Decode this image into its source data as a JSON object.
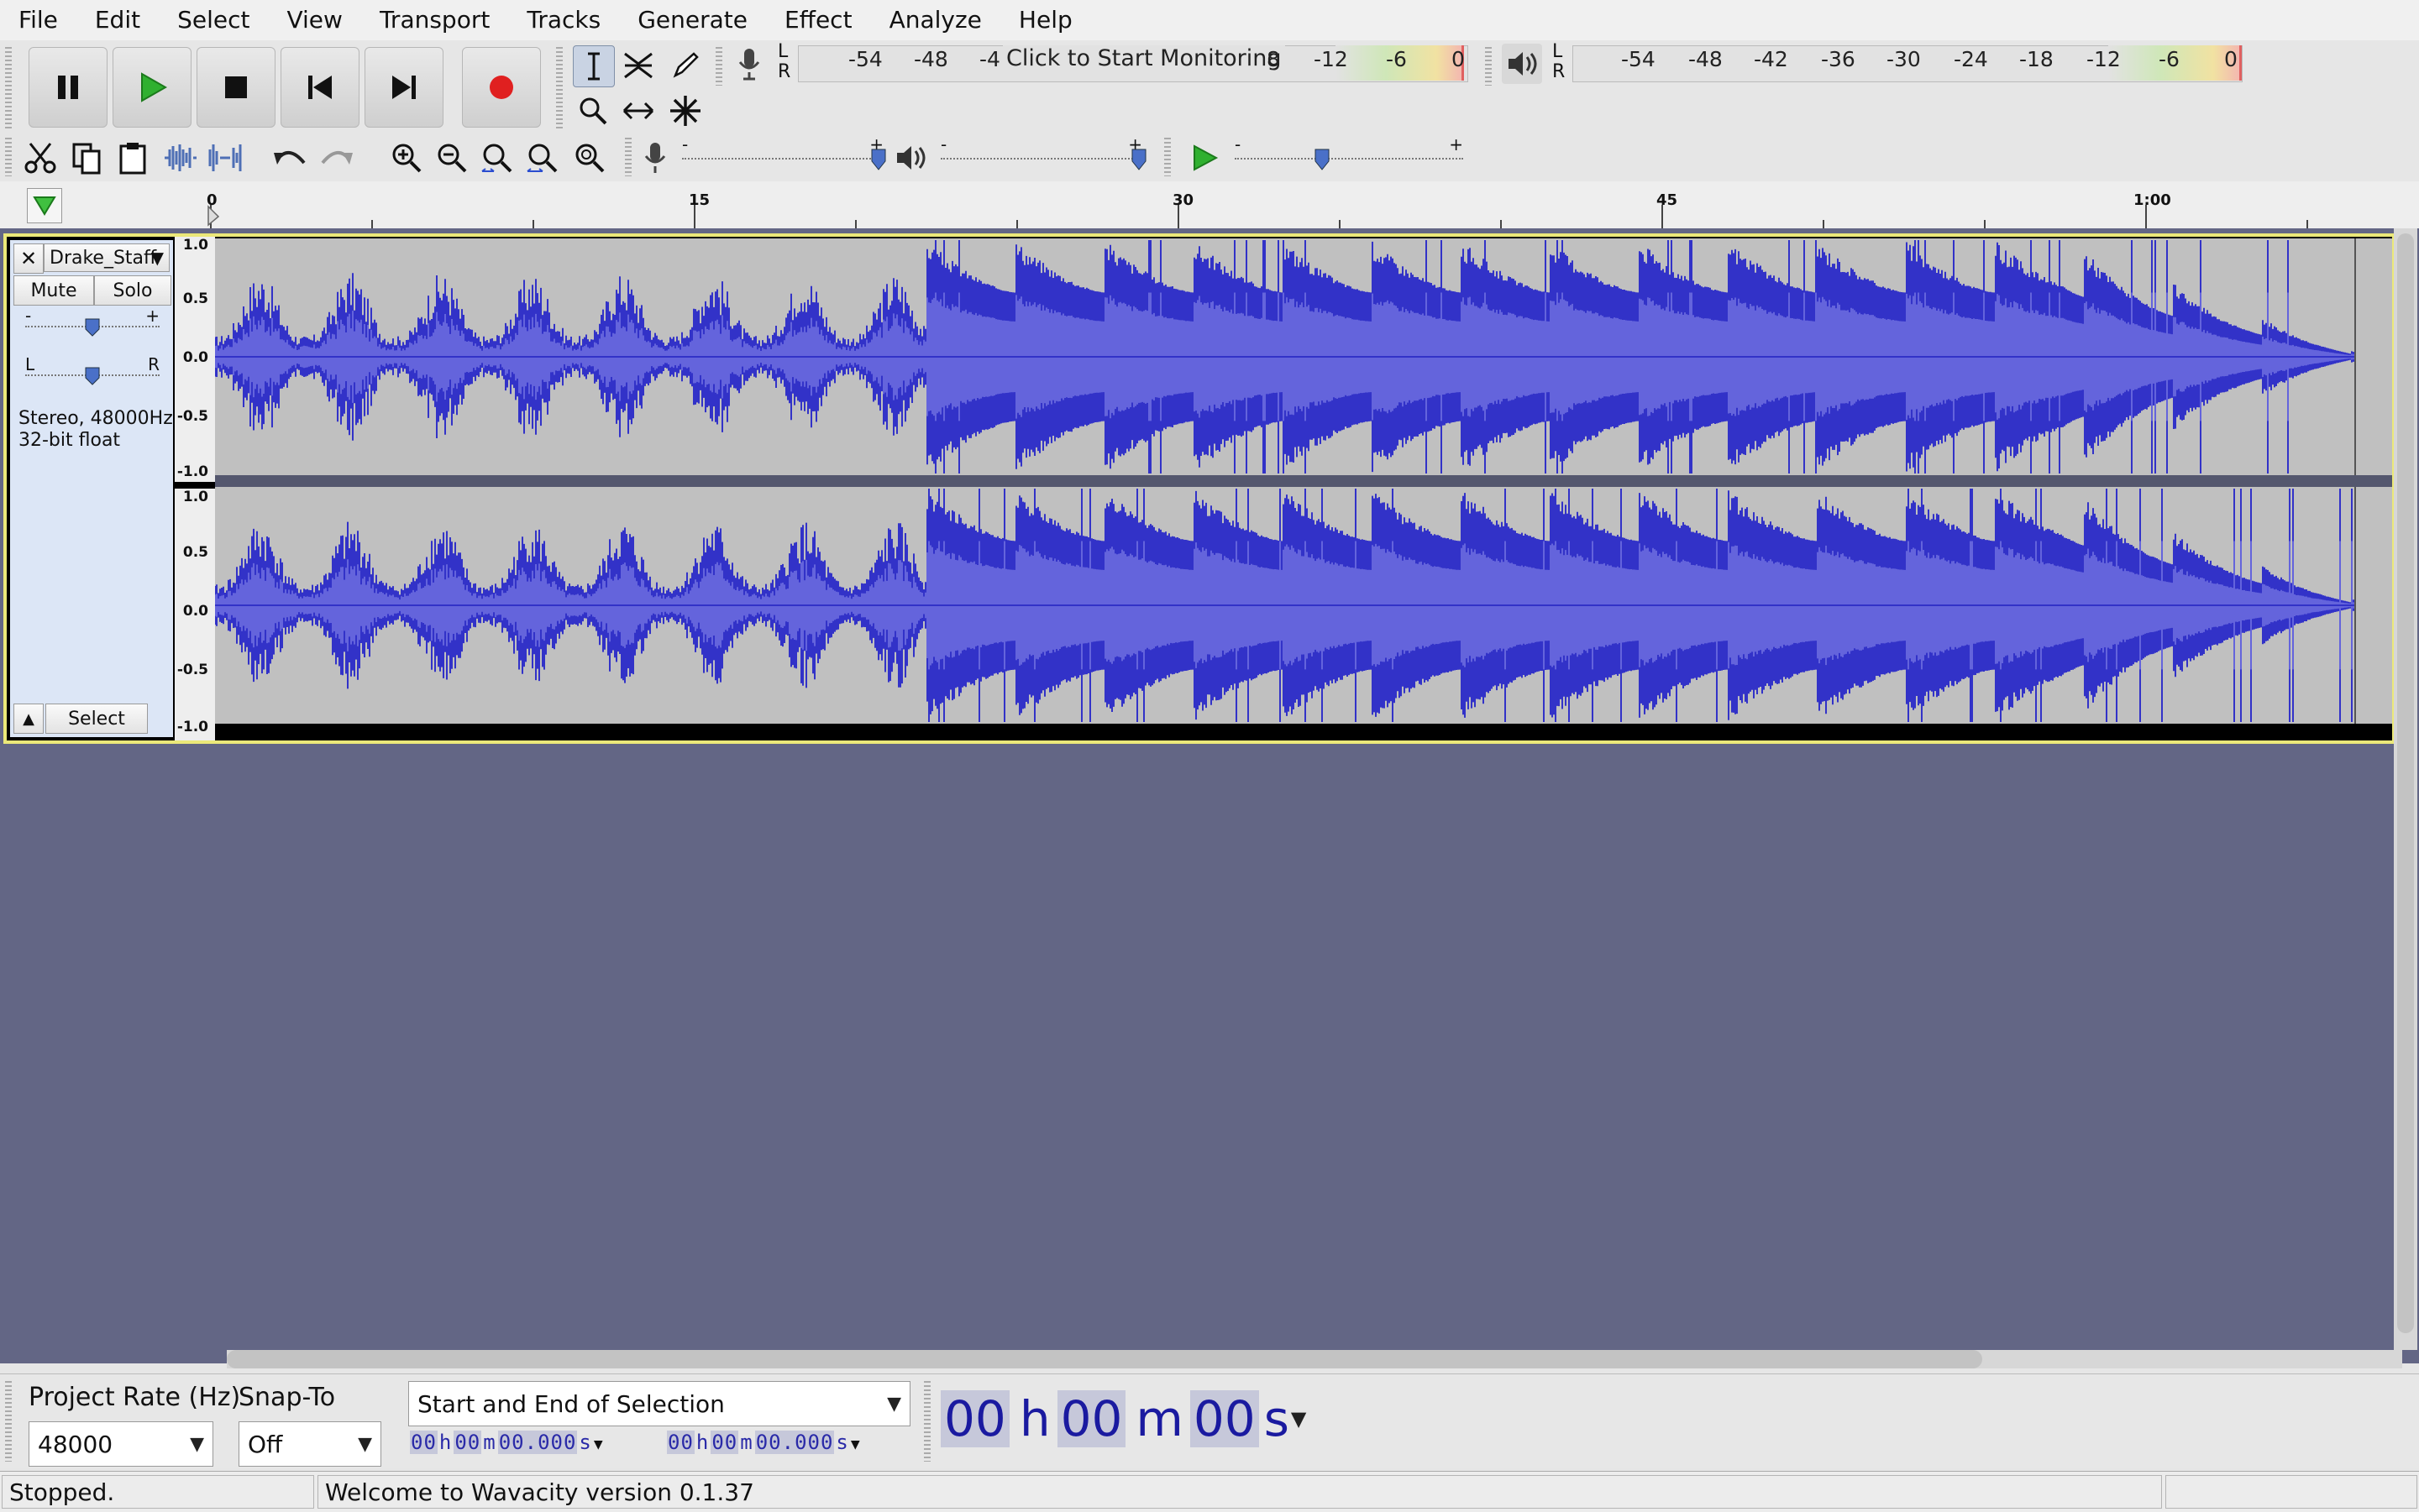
{
  "menu": [
    "File",
    "Edit",
    "Select",
    "View",
    "Transport",
    "Tracks",
    "Generate",
    "Effect",
    "Analyze",
    "Help"
  ],
  "record_meter": {
    "channels": [
      "L",
      "R"
    ],
    "ticks": [
      "-54",
      "-48",
      "-4",
      "8",
      "-12",
      "-6",
      "0"
    ],
    "prompt": "Click to Start Monitoring"
  },
  "playback_meter": {
    "channels": [
      "L",
      "R"
    ],
    "ticks": [
      "-54",
      "-48",
      "-42",
      "-36",
      "-30",
      "-24",
      "-18",
      "-12",
      "-6",
      "0"
    ]
  },
  "sliders": {
    "mic_minus": "-",
    "mic_plus": "+",
    "speaker_minus": "-",
    "speaker_plus": "+",
    "speed_minus": "-",
    "speed_plus": "+"
  },
  "ruler": {
    "labels": [
      "0",
      "15",
      "30",
      "45",
      "1:00"
    ]
  },
  "track": {
    "name": "Drake_Staff",
    "mute": "Mute",
    "solo": "Solo",
    "gain_minus": "-",
    "gain_plus": "+",
    "pan_left": "L",
    "pan_right": "R",
    "info_line1": "Stereo, 48000Hz",
    "info_line2": "32-bit float",
    "select": "Select",
    "scale": [
      "1.0",
      "0.5",
      "0.0",
      "-0.5",
      "-1.0"
    ]
  },
  "selection_toolbar": {
    "project_rate_label": "Project Rate (Hz)",
    "project_rate_value": "48000",
    "snap_label": "Snap-To",
    "snap_value": "Off",
    "selection_mode": "Start and End of Selection",
    "start_time": {
      "h": "00",
      "m": "00",
      "s": "00.000"
    },
    "end_time": {
      "h": "00",
      "m": "00",
      "s": "00.000"
    },
    "units": {
      "h": "h",
      "m": "m",
      "s": "s"
    },
    "audio_position": {
      "h": "00",
      "m": "00",
      "s": "00"
    }
  },
  "status": {
    "state": "Stopped.",
    "message": "Welcome to Wavacity version 0.1.37"
  },
  "colors": {
    "waveform": "#3232c8",
    "waveform_rms": "#6464dc",
    "track_bg": "#c0c0c0",
    "track_border": "#ebe879",
    "record": "#e02020",
    "play": "#30b030"
  }
}
